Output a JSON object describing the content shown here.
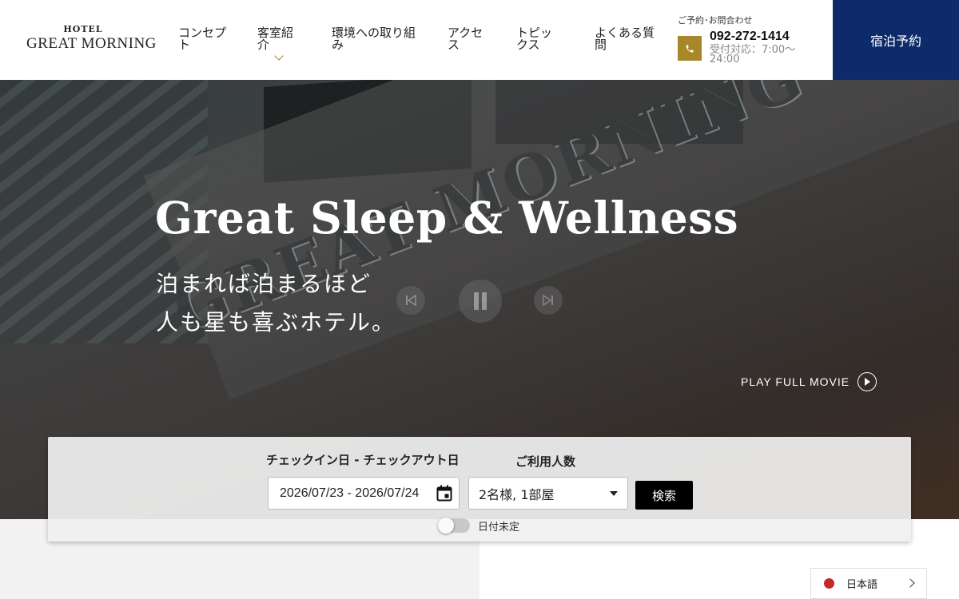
{
  "header": {
    "logo_small": "HOTEL",
    "logo_big": "GREAT MORNING",
    "nav": [
      {
        "label": "コンセプト"
      },
      {
        "label": "客室紹介"
      },
      {
        "label": "環境への取り組み"
      },
      {
        "label": "アクセス"
      },
      {
        "label": "トピックス"
      },
      {
        "label": "よくある質問"
      }
    ],
    "contact_label": "ご予約･お問合わせ",
    "phone": "092-272-1414",
    "hours": "受付対応：7:00〜24:00",
    "reserve_label": "宿泊予約",
    "accent_color": "#a8862a",
    "reserve_color": "#0d2a6b"
  },
  "hero": {
    "title": "Great Sleep & Wellness",
    "subtitle_line1": "泊まれば泊まるほど",
    "subtitle_line2": "人も星も喜ぶホテル。",
    "sign_text": "GREAT MORNING",
    "play_movie_label": "PLAY FULL MOVIE",
    "controls": [
      "previous-icon",
      "pause-icon",
      "next-icon"
    ]
  },
  "search": {
    "dates_label": "チェックイン日 - チェックアウト日",
    "guests_label": "ご利用人数",
    "dates_value": "2026/07/23 - 2026/07/24",
    "guests_value": "2名様, 1部屋",
    "search_label": "検索",
    "undecided_label": "日付未定",
    "undecided_on": false
  },
  "language": {
    "label": "日本語"
  }
}
